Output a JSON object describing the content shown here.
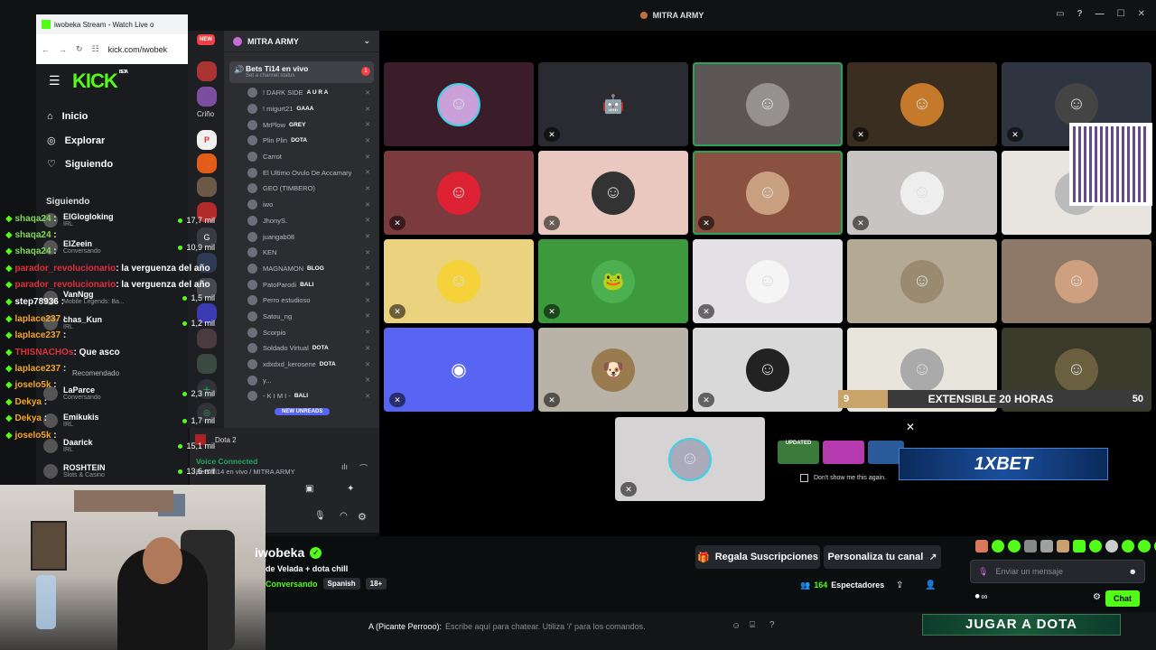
{
  "browser": {
    "tab_title": "iwobeka Stream - Watch Live o",
    "url": "kick.com/iwobek"
  },
  "kick": {
    "logo": "KICK",
    "logo_sup": "BETA",
    "nav": [
      {
        "label": "Inicio",
        "icon": "home-icon"
      },
      {
        "label": "Explorar",
        "icon": "compass-icon"
      },
      {
        "label": "Siguiendo",
        "icon": "heart-icon"
      }
    ],
    "following_header": "Siguiendo",
    "recommended_header": "Recomendado",
    "following": [
      {
        "name": "ElGlogloking",
        "sub": "IRL",
        "viewers": "17,7 mil"
      },
      {
        "name": "ElZeein",
        "sub": "Conversando",
        "viewers": "10,9 mil"
      },
      {
        "name": "VanNgg",
        "sub": "Mobile Legends: Ba...",
        "viewers": "1,5 mil"
      },
      {
        "name": "chas_Kun",
        "sub": "IRL",
        "viewers": "1,2 mil"
      },
      {
        "name": "LaParce",
        "sub": "Conversando",
        "viewers": "2,3 mil"
      },
      {
        "name": "Emikukis",
        "sub": "IRL",
        "viewers": "1,7 mil"
      },
      {
        "name": "Daarick",
        "sub": "IRL",
        "viewers": "15,1 mil"
      },
      {
        "name": "ROSHTEIN",
        "sub": "Slots & Casino",
        "viewers": "13,6 mil"
      }
    ],
    "channel_name": "iwobeka",
    "stream_title": "de Velada + dota chill",
    "category": "Conversando",
    "language": "Spanish",
    "age": "18+",
    "subs_button": "Regala Suscripciones",
    "custom_button": "Personaliza tu canal",
    "viewers_count": "164",
    "viewers_label": "Espectadores",
    "chat_placeholder": "Enviar un mensaje",
    "chat_button": "Chat",
    "banner": "JUGAR A DOTA"
  },
  "chat_overlay": [
    {
      "user": "shaqa24",
      "msg": "",
      "color": "#7ed957"
    },
    {
      "user": "shaqa24",
      "msg": "",
      "color": "#7ed957"
    },
    {
      "user": "shaqa24",
      "msg": "",
      "color": "#7ed957"
    },
    {
      "user": "parador_revolucionario",
      "msg": ": la verguenza del año",
      "color": "#e0303a"
    },
    {
      "user": "parador_revolucionario",
      "msg": ": la verguenza del año",
      "color": "#e0303a"
    },
    {
      "user": "step78936",
      "msg": "",
      "color": "#ffffff"
    },
    {
      "user": "laplace237",
      "msg": "",
      "color": "#f5a524"
    },
    {
      "user": "laplace237",
      "msg": "",
      "color": "#f5a524"
    },
    {
      "user": "THISNACHOs",
      "msg": ": Que asco",
      "color": "#e0303a"
    },
    {
      "user": "laplace237",
      "msg": "",
      "color": "#f5a524"
    },
    {
      "user": "joselo5k",
      "msg": "",
      "color": "#f5a524"
    },
    {
      "user": "Dekya",
      "msg": "",
      "color": "#f5a524"
    },
    {
      "user": "Dekya",
      "msg": "",
      "color": "#f5a524"
    },
    {
      "user": "joselo5k",
      "msg": "",
      "color": "#f5a524"
    }
  ],
  "discord": {
    "window_title": "MITRA ARMY",
    "server_name": "MITRA ARMY",
    "new_badge": "NEW",
    "channel": "Bets Ti14 en vivo",
    "channel_status": "Set a channel status",
    "channel_badge": "1",
    "server_label": "Criño",
    "voice_users": [
      {
        "name": "! DARK SIDE",
        "tag": "A U R A"
      },
      {
        "name": "! migurt21",
        "tag": "GAAA"
      },
      {
        "name": "MrPlow",
        "tag": "GREY"
      },
      {
        "name": "Plin Plin",
        "tag": "DOTA"
      },
      {
        "name": "Carrot",
        "tag": ""
      },
      {
        "name": "El Ultimo Ovulo De Accamary",
        "tag": ""
      },
      {
        "name": "GEO (TIMBERO)",
        "tag": ""
      },
      {
        "name": "iwo",
        "tag": ""
      },
      {
        "name": "JhonyS.",
        "tag": ""
      },
      {
        "name": "juangab08",
        "tag": ""
      },
      {
        "name": "KEN",
        "tag": ""
      },
      {
        "name": "MAGNAMON",
        "tag": "BLOG"
      },
      {
        "name": "PatoParodi",
        "tag": "BALI"
      },
      {
        "name": "Perro estudioso",
        "tag": ""
      },
      {
        "name": "Satou_ng",
        "tag": ""
      },
      {
        "name": "Scorpio",
        "tag": ""
      },
      {
        "name": "Soldado Virtual",
        "tag": "DOTA"
      },
      {
        "name": "xdxdxd_kerosene",
        "tag": "DOTA"
      },
      {
        "name": "y...",
        "tag": ""
      },
      {
        "name": "- K I M I -",
        "tag": "BALI"
      }
    ],
    "new_unreads": "NEW UNREADS",
    "activity": "Dota 2",
    "voice_connected": "Voice Connected",
    "voice_channel": "Bets Ti14 en vivo / MITRA ARMY",
    "dont_show": "Don't show me this again.",
    "popup_tags": [
      "UPDATED"
    ],
    "bet_brand": "1XBET",
    "bar_left": "9",
    "bar_text": "EXTENSIBLE 20 HORAS",
    "bar_right": "50",
    "chat_input_prefix": "A (Picante Perrooo):",
    "chat_input_placeholder": "Escribe aquí para chatear. Utiliza '/' para los comandos."
  },
  "colors": {
    "kick_green": "#53fc18",
    "discord_green": "#23a55a",
    "discord_blurple": "#5865f2"
  }
}
